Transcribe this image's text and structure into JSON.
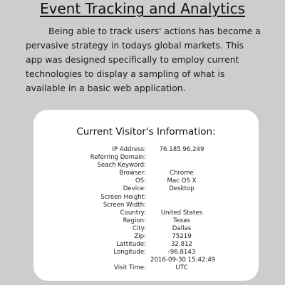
{
  "page": {
    "title": "Event Tracking and Analytics",
    "intro": "Being able to track users' actions has become a pervasive strategy in todays global markets. This app was designed specifically to employ current technologies to display a sampling of what is available in a basic web application."
  },
  "visitor_card": {
    "title": "Current Visitor's Information:",
    "rows": [
      {
        "label": "IP Address:",
        "value": "76.185.96.249"
      },
      {
        "label": "Referring Domain:",
        "value": ""
      },
      {
        "label": "Seach Keyword:",
        "value": ""
      },
      {
        "label": "Browser:",
        "value": "Chrome"
      },
      {
        "label": "OS:",
        "value": "Mac OS X"
      },
      {
        "label": "Device:",
        "value": "Desktop"
      },
      {
        "label": "Screen Height:",
        "value": ""
      },
      {
        "label": "Screen Width:",
        "value": ""
      },
      {
        "label": "Country:",
        "value": "United States"
      },
      {
        "label": "Region:",
        "value": "Texas"
      },
      {
        "label": "City:",
        "value": "Dallas"
      },
      {
        "label": "Zip:",
        "value": "75219"
      },
      {
        "label": "Lattitude:",
        "value": "32.812"
      },
      {
        "label": "Longitude:",
        "value": "-96.8143"
      },
      {
        "label": "",
        "value": "2016-09-30 15:42:49"
      },
      {
        "label": "Visit Time:",
        "value": "UTC"
      }
    ]
  },
  "colors": {
    "background": "#cdcdcd",
    "card": "#ffffff",
    "text": "#111111"
  }
}
